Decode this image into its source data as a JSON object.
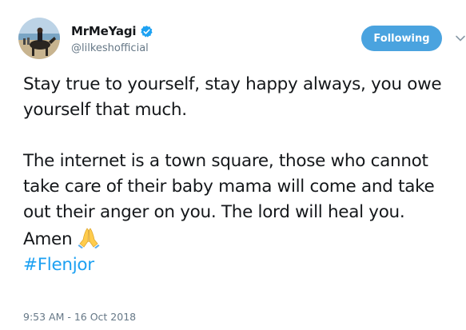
{
  "author": {
    "display_name": "MrMeYagi",
    "handle": "@lilkeshofficial",
    "verified": true,
    "avatar_icon": "avatar-horse-rider-photo"
  },
  "actions": {
    "follow_label": "Following",
    "menu_icon": "chevron-down-icon"
  },
  "tweet": {
    "paragraph1": "Stay true to yourself, stay happy always, you owe yourself that much.",
    "paragraph2": "The internet is a town square, those who cannot take care of their baby mama will come and take out their anger on you. The lord will heal you.",
    "amen": "Amen",
    "amen_emoji": "folded-hands-icon",
    "hashtag": "#Flenjor",
    "timestamp": "9:53 AM - 16 Oct 2018"
  },
  "colors": {
    "text": "#14171a",
    "secondary": "#657786",
    "link": "#1da1f2",
    "follow_button": "#4aa3df",
    "verified": "#1da1f2"
  }
}
